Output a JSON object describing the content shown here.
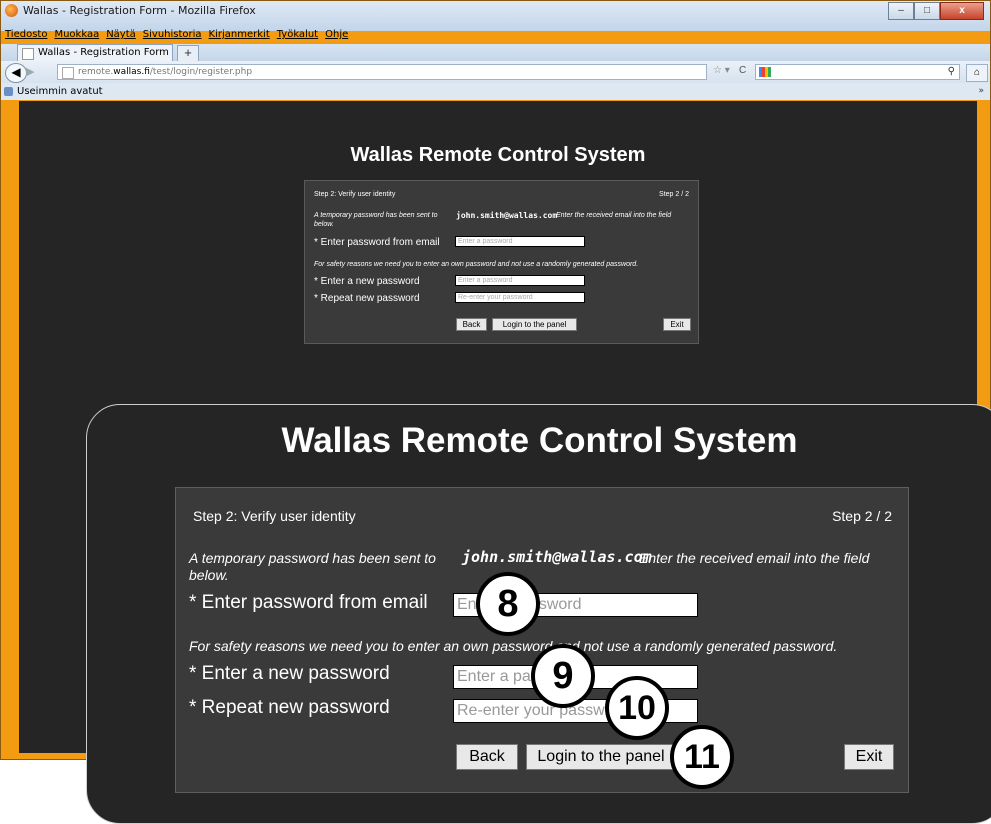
{
  "browser": {
    "title": "Wallas - Registration Form - Mozilla Firefox",
    "menu": [
      "Tiedosto",
      "Muokkaa",
      "Näytä",
      "Sivuhistoria",
      "Kirjanmerkit",
      "Työkalut",
      "Ohje"
    ],
    "tab_label": "Wallas - Registration Form",
    "new_tab": "+",
    "url_prefix": "remote.",
    "url_domain": "wallas.fi",
    "url_path": "/test/login/register.php",
    "bookmark": "Useimmin avatut",
    "bookmarks_more": "»",
    "win_min": "–",
    "win_max": "□",
    "win_close": "x"
  },
  "page": {
    "title": "Wallas Remote Control System",
    "step_label": "Step 2: Verify user identity",
    "step_counter": "Step 2 / 2",
    "temp_msg": "A temporary password has been sent to",
    "email": "john.smith@wallas.com",
    "temp_msg_tail": "Enter the received email into the field",
    "temp_msg_tail2": "below.",
    "field_email_pw": "* Enter password from email",
    "field_email_pw_placeholder": "Enter a password",
    "safety_msg": "For safety reasons we need you to enter an own password and not use a randomly generated password.",
    "field_new_pw": "* Enter a new password",
    "field_new_pw_placeholder": "Enter a password",
    "field_repeat_pw": "* Repeat new password",
    "field_repeat_pw_placeholder": "Re-enter your password",
    "btn_back": "Back",
    "btn_login": "Login to the panel",
    "btn_exit": "Exit"
  },
  "callouts": [
    "8",
    "9",
    "10",
    "11"
  ]
}
